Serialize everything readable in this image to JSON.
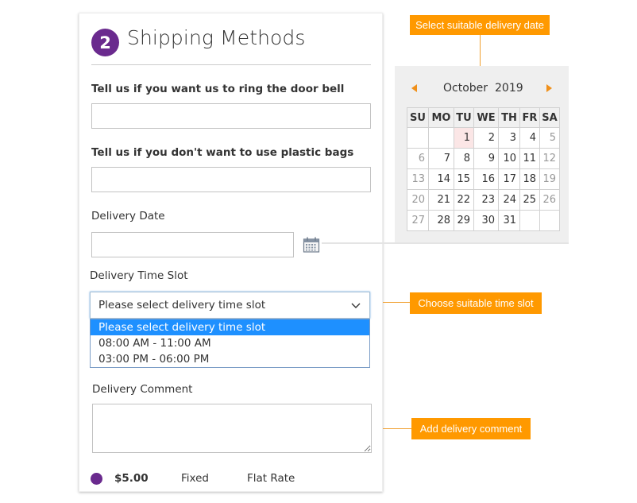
{
  "shipping": {
    "step_number": "2",
    "title": "Shipping Methods",
    "fields": {
      "door_bell": {
        "label": "Tell us if you want us to ring the door bell",
        "value": "",
        "placeholder": ""
      },
      "plastic_bags": {
        "label": "Tell us if you don't want to use plastic bags",
        "value": "",
        "placeholder": ""
      },
      "delivery_date": {
        "label": "Delivery Date",
        "value": "",
        "placeholder": "",
        "icon": "calendar-icon"
      },
      "time_slot": {
        "label": "Delivery Time Slot",
        "selected": "Please select delivery time slot",
        "options": [
          {
            "label": "Please select delivery time slot",
            "highlighted": true
          },
          {
            "label": "08:00 AM - 11:00 AM",
            "highlighted": false
          },
          {
            "label": "03:00 PM - 06:00 PM",
            "highlighted": false
          }
        ]
      },
      "comment": {
        "label": "Delivery Comment",
        "value": ""
      }
    },
    "method": {
      "price": "$5.00",
      "type": "Fixed",
      "carrier": "Flat Rate",
      "selected": true
    }
  },
  "calendar": {
    "month": "October",
    "year": "2019",
    "weekdays": [
      "SU",
      "MO",
      "TU",
      "WE",
      "TH",
      "FR",
      "SA"
    ],
    "today": "1",
    "weeks": [
      [
        "",
        "",
        "1",
        "2",
        "3",
        "4",
        "5"
      ],
      [
        "6",
        "7",
        "8",
        "9",
        "10",
        "11",
        "12"
      ],
      [
        "13",
        "14",
        "15",
        "16",
        "17",
        "18",
        "19"
      ],
      [
        "20",
        "21",
        "22",
        "23",
        "24",
        "25",
        "26"
      ],
      [
        "27",
        "28",
        "29",
        "30",
        "31",
        "",
        ""
      ]
    ]
  },
  "callouts": {
    "date": "Select suitable delivery date",
    "time_slot": "Choose suitable time slot",
    "comment": "Add delivery comment"
  },
  "colors": {
    "brand_purple": "#6a2a8e",
    "callout_orange": "#ff9900",
    "selection_blue": "#1e90ff"
  }
}
